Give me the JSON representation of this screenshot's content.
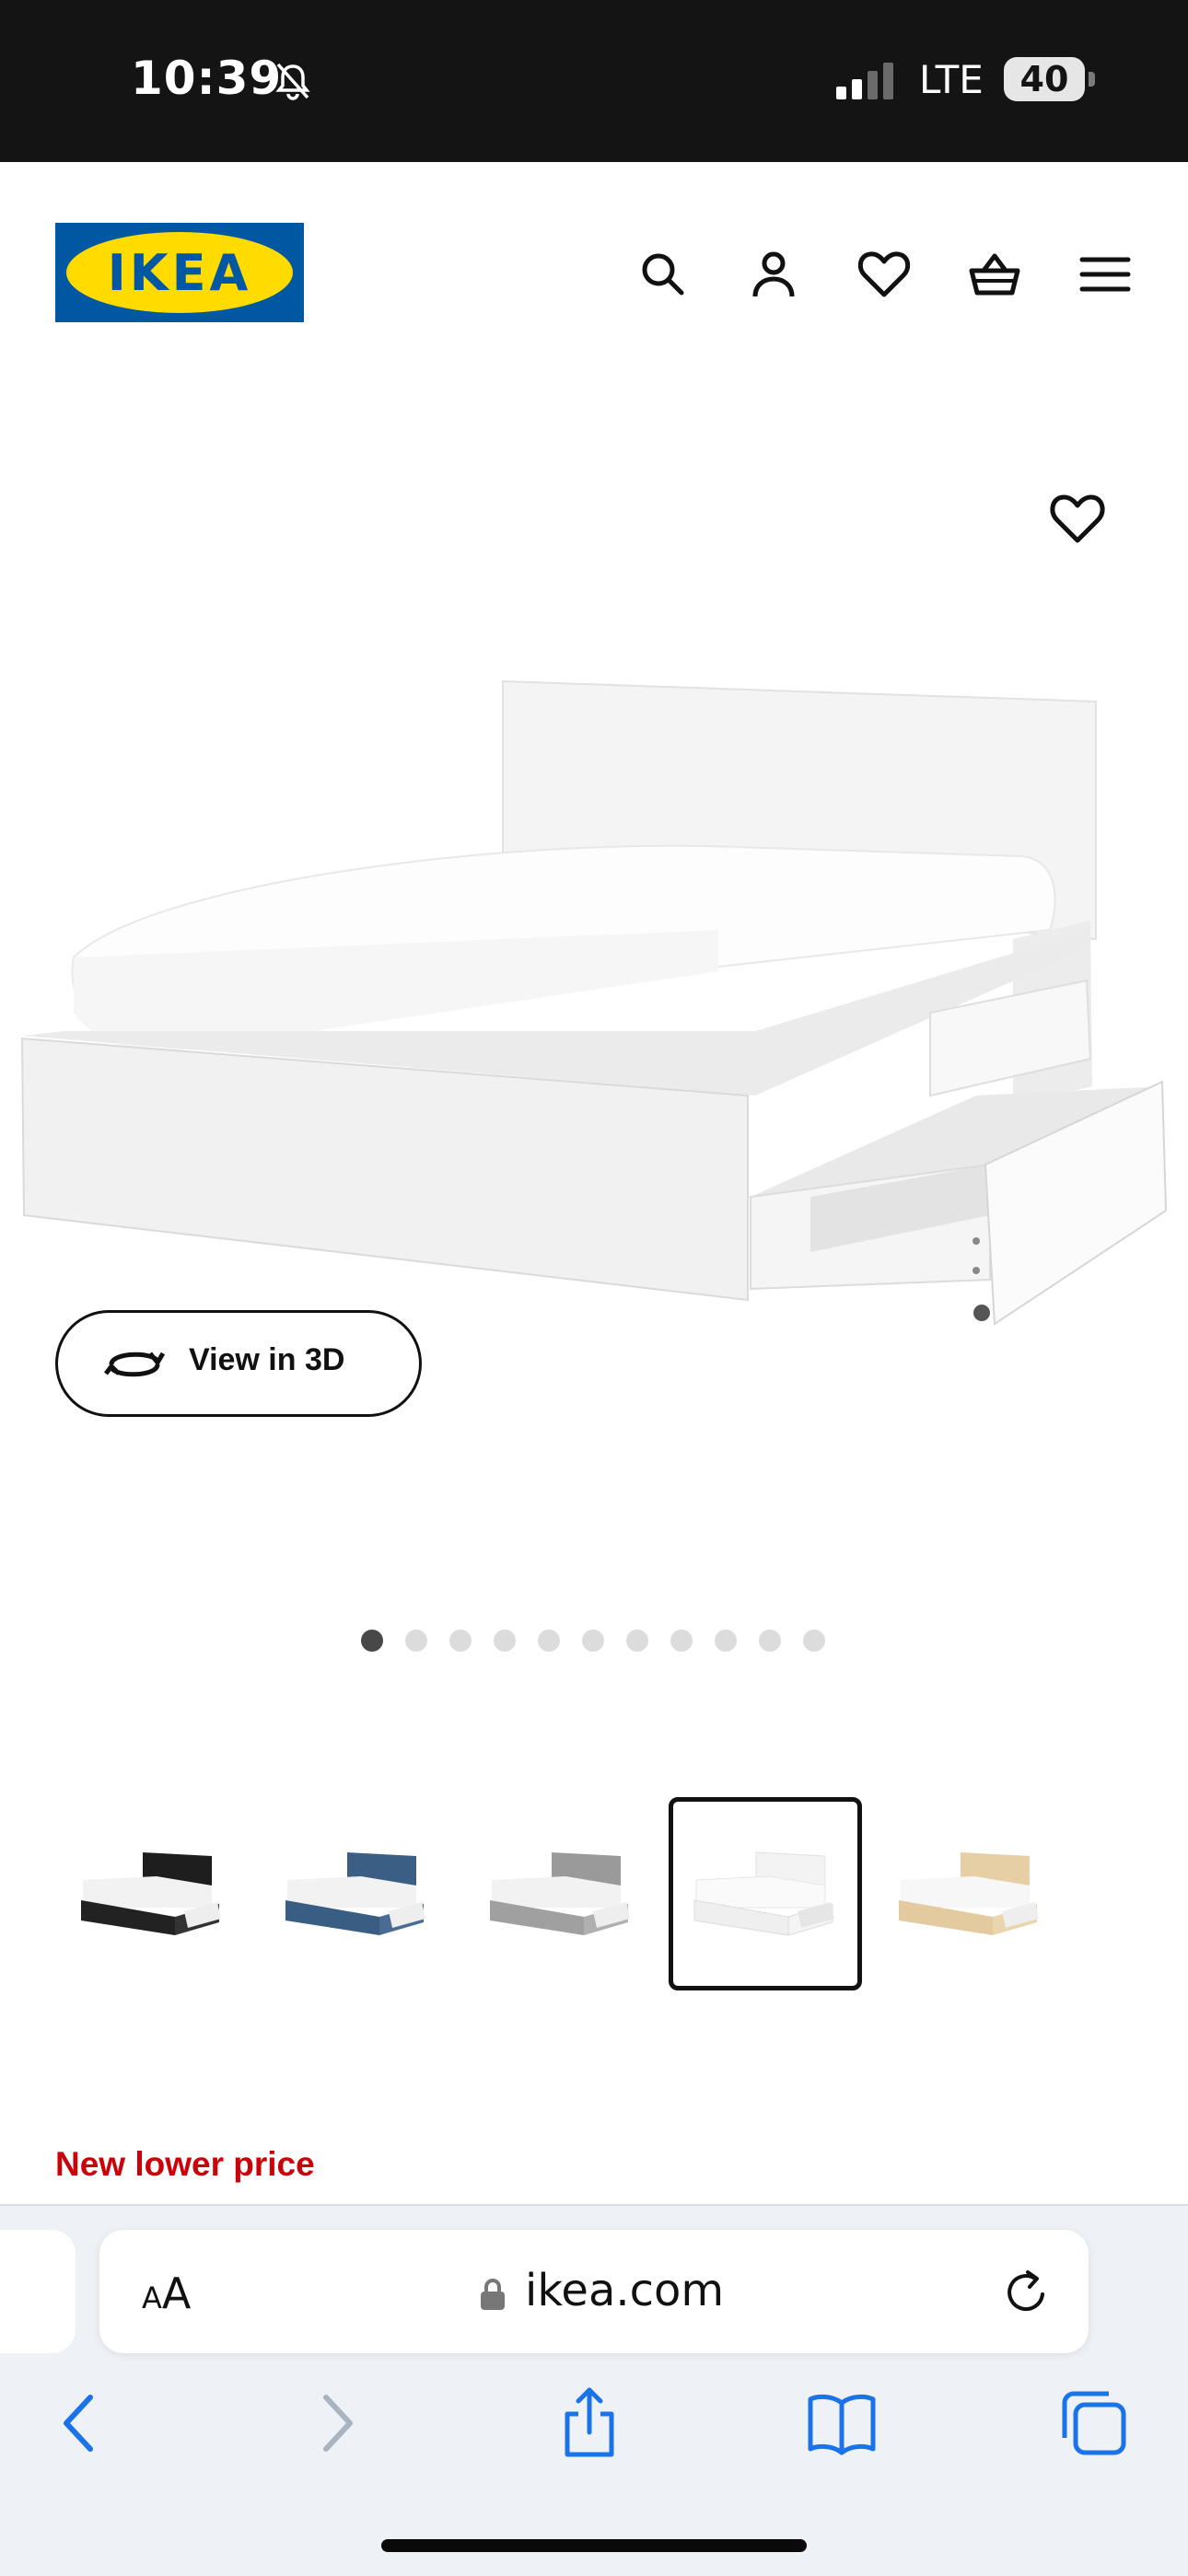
{
  "status_bar": {
    "time": "10:39",
    "network": "LTE",
    "battery": "40",
    "icons": [
      "bell-slash-icon",
      "signal-icon"
    ]
  },
  "header": {
    "logo_text": "IKEA",
    "brand_colors": {
      "blue": "#0058a3",
      "yellow": "#ffdb00"
    },
    "icons": [
      "search-icon",
      "account-icon",
      "heart-icon",
      "basket-icon",
      "menu-icon"
    ]
  },
  "product": {
    "favorite_icon": "heart-icon",
    "view_3d_label": "View in 3D",
    "image_count": 11,
    "active_image_index": 0,
    "color_variants": [
      "black-brown",
      "blue",
      "gray",
      "white",
      "white-stained-oak"
    ],
    "selected_variant_index": 3,
    "price_label": "New lower price",
    "price_label_color": "#cc0008"
  },
  "browser": {
    "text_size_label_small": "A",
    "text_size_label_large": "A",
    "url": "ikea.com",
    "accent_color": "#1a73e8",
    "toolbar_icons": [
      "back-icon",
      "forward-icon",
      "share-icon",
      "bookmarks-icon",
      "tabs-icon"
    ]
  }
}
